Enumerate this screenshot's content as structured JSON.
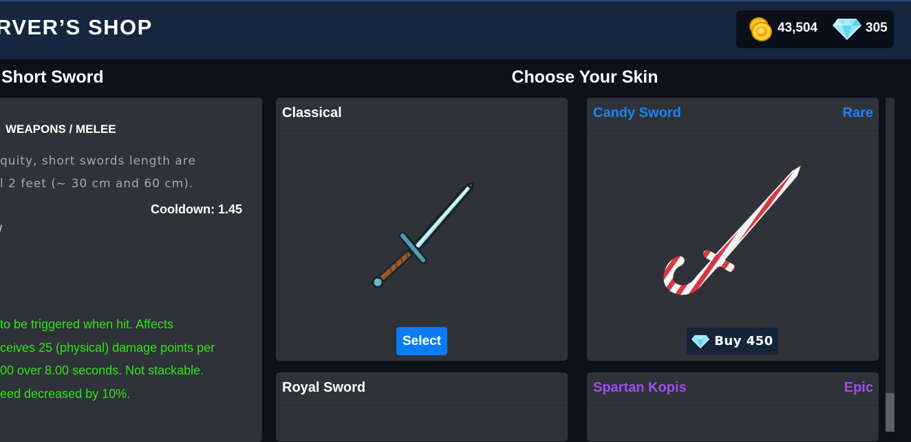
{
  "header": {
    "title": "RVER’S SHOP",
    "gold": "43,504",
    "gems": "305"
  },
  "item": {
    "name": "Short Sword",
    "category": "WEAPONS / MELEE",
    "description": [
      "quity, short swords length are",
      "l 2 feet (~ 30 cm and 60 cm)."
    ],
    "cooldown": "Cooldown: 1.45",
    "tick": "/",
    "effect": [
      "to be triggered when hit. Affects",
      "ceives 25 (physical) damage points per",
      "00 over 8.00 seconds. Not stackable.",
      "eed decreased by 10%."
    ]
  },
  "skins": {
    "heading": "Choose Your Skin",
    "cards": [
      {
        "title": "Classical",
        "rarity": "",
        "action": "Select",
        "title_color": "#ffffff"
      },
      {
        "title": "Candy Sword",
        "rarity": "Rare",
        "action": "Buy 450",
        "title_color": "#1a84f2"
      },
      {
        "title": "Royal Sword",
        "rarity": "",
        "action": "",
        "title_color": "#ffffff"
      },
      {
        "title": "Spartan Kopis",
        "rarity": "Epic",
        "action": "",
        "title_color": "#9d4ef0"
      }
    ]
  },
  "colors": {
    "rare": "#1a84f2",
    "epic": "#9d4ef0",
    "effect_text": "#2fe21c",
    "select_button": "#0b7cf5"
  },
  "icons": {
    "gold": "gold-coins-icon",
    "gem": "diamond-icon"
  }
}
